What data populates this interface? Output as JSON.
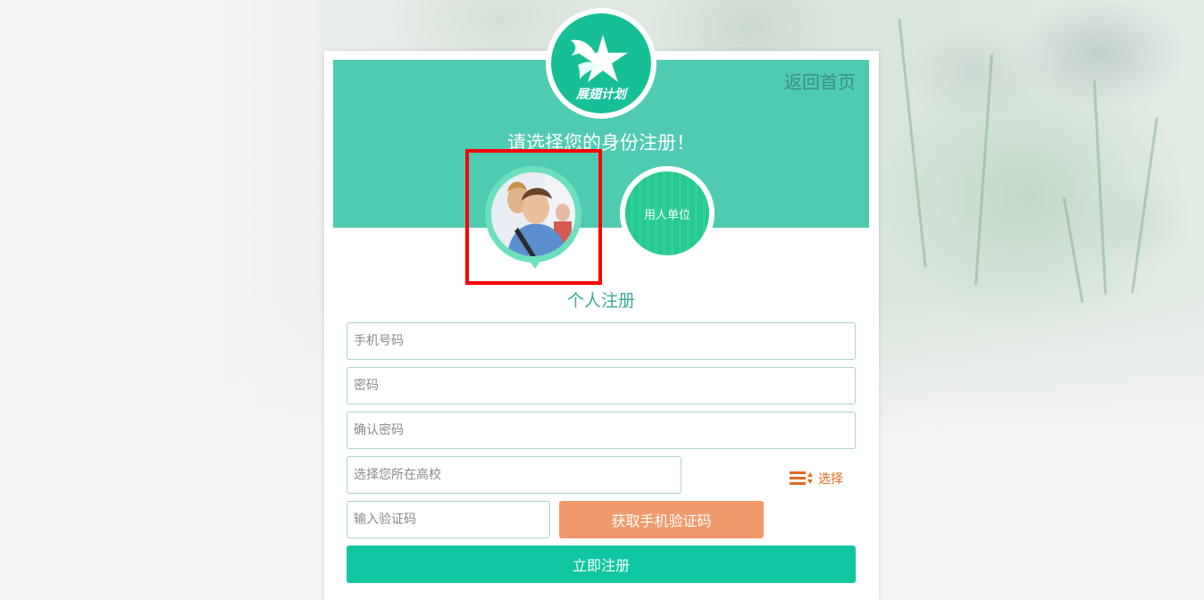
{
  "nav": {
    "back_home": "返回首页"
  },
  "logo": {
    "text": "展翅计划"
  },
  "header": {
    "title": "请选择您的身份注册！"
  },
  "roles": {
    "personal": {
      "image": "student-photo",
      "selected": true
    },
    "company": {
      "label": "用人单位"
    }
  },
  "form": {
    "title": "个人注册",
    "phone": {
      "placeholder": "手机号码",
      "value": ""
    },
    "password": {
      "placeholder": "密码",
      "value": ""
    },
    "confirm_password": {
      "placeholder": "确认密码",
      "value": ""
    },
    "school": {
      "placeholder": "选择您所在高校",
      "value": ""
    },
    "choose_label": "选择",
    "code": {
      "placeholder": "输入验证码",
      "value": ""
    },
    "get_code_label": "获取手机验证码",
    "submit_label": "立即注册"
  },
  "colors": {
    "banner": "#4fcbb2",
    "accent": "#0fc6a0",
    "code_button": "#f0996a",
    "choose": "#e06a1d",
    "highlight": "#ff0000"
  }
}
